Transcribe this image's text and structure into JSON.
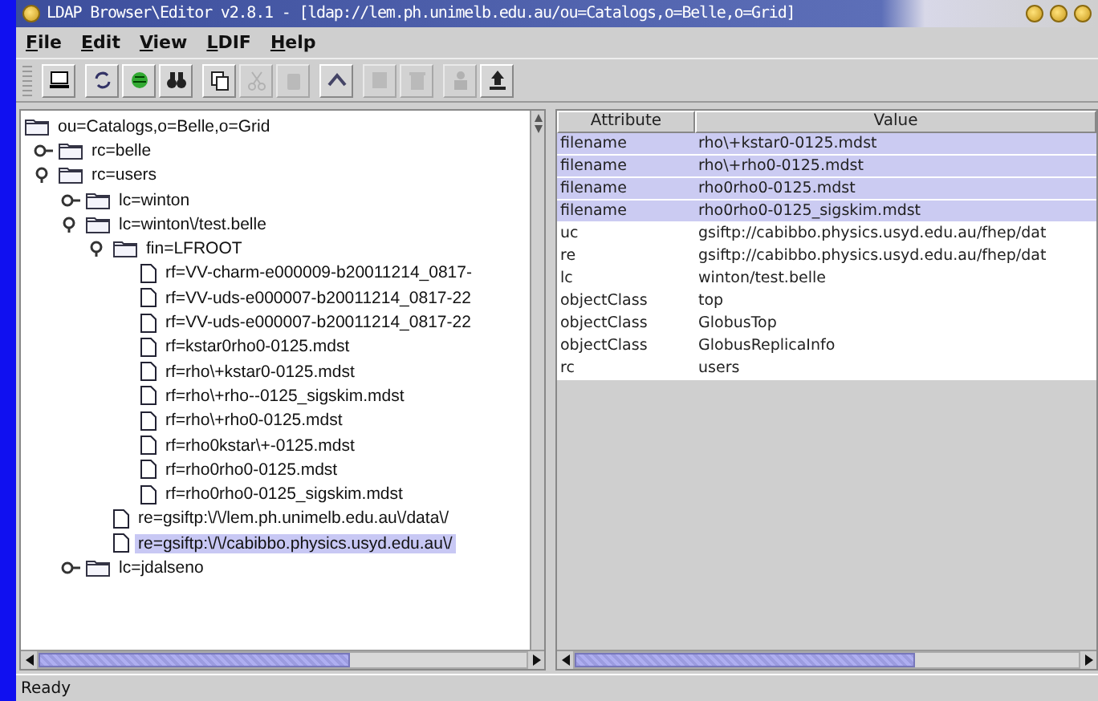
{
  "window": {
    "title": "LDAP Browser\\Editor v2.8.1 - [ldap://lem.ph.unimelb.edu.au/ou=Catalogs,o=Belle,o=Grid]"
  },
  "menu": [
    "File",
    "Edit",
    "View",
    "LDIF",
    "Help"
  ],
  "toolbar": [
    {
      "disabled": false
    },
    {
      "disabled": false
    },
    {
      "disabled": false
    },
    {
      "disabled": false
    },
    {
      "disabled": false
    },
    {
      "disabled": true
    },
    {
      "disabled": true
    },
    {
      "disabled": false
    },
    {
      "disabled": true
    },
    {
      "disabled": true
    },
    {
      "disabled": true
    },
    {
      "disabled": false
    }
  ],
  "tree": [
    {
      "label": "ou=Catalogs,o=Belle,o=Grid",
      "kind": "folder",
      "selected": false,
      "children": [
        {
          "label": "rc=belle",
          "kind": "folder",
          "expanded": false,
          "selected": false
        },
        {
          "label": "rc=users",
          "kind": "folder",
          "expanded": true,
          "selected": false,
          "children": [
            {
              "label": "lc=winton",
              "kind": "folder",
              "expanded": false,
              "selected": false
            },
            {
              "label": "lc=winton\\/test.belle",
              "kind": "folder",
              "expanded": true,
              "selected": false,
              "children": [
                {
                  "label": "fin=LFROOT",
                  "kind": "folder",
                  "expanded": true,
                  "selected": false,
                  "children": [
                    {
                      "label": "rf=VV-charm-e000009-b20011214_0817-",
                      "kind": "file",
                      "selected": false
                    },
                    {
                      "label": "rf=VV-uds-e000007-b20011214_0817-22",
                      "kind": "file",
                      "selected": false
                    },
                    {
                      "label": "rf=VV-uds-e000007-b20011214_0817-22",
                      "kind": "file",
                      "selected": false
                    },
                    {
                      "label": "rf=kstar0rho0-0125.mdst",
                      "kind": "file",
                      "selected": false
                    },
                    {
                      "label": "rf=rho\\+kstar0-0125.mdst",
                      "kind": "file",
                      "selected": false
                    },
                    {
                      "label": "rf=rho\\+rho--0125_sigskim.mdst",
                      "kind": "file",
                      "selected": false
                    },
                    {
                      "label": "rf=rho\\+rho0-0125.mdst",
                      "kind": "file",
                      "selected": false
                    },
                    {
                      "label": "rf=rho0kstar\\+-0125.mdst",
                      "kind": "file",
                      "selected": false
                    },
                    {
                      "label": "rf=rho0rho0-0125.mdst",
                      "kind": "file",
                      "selected": false
                    },
                    {
                      "label": "rf=rho0rho0-0125_sigskim.mdst",
                      "kind": "file",
                      "selected": false
                    }
                  ]
                },
                {
                  "label": "re=gsiftp:\\/\\/lem.ph.unimelb.edu.au\\/data\\/",
                  "kind": "file",
                  "selected": false
                },
                {
                  "label": "re=gsiftp:\\/\\/cabibbo.physics.usyd.edu.au\\/",
                  "kind": "file",
                  "selected": true
                }
              ]
            },
            {
              "label": "lc=jdalseno",
              "kind": "folder",
              "expanded": false,
              "selected": false
            }
          ]
        }
      ]
    }
  ],
  "table": {
    "columns": [
      "Attribute",
      "Value"
    ],
    "rows": [
      {
        "attribute": "filename",
        "value": "rho\\+kstar0-0125.mdst",
        "selected": true
      },
      {
        "attribute": "filename",
        "value": "rho\\+rho0-0125.mdst",
        "selected": true
      },
      {
        "attribute": "filename",
        "value": "rho0rho0-0125.mdst",
        "selected": true
      },
      {
        "attribute": "filename",
        "value": "rho0rho0-0125_sigskim.mdst",
        "selected": true
      },
      {
        "attribute": "uc",
        "value": "gsiftp://cabibbo.physics.usyd.edu.au/fhep/dat",
        "selected": false
      },
      {
        "attribute": "re",
        "value": "gsiftp://cabibbo.physics.usyd.edu.au/fhep/dat",
        "selected": false
      },
      {
        "attribute": "lc",
        "value": "winton/test.belle",
        "selected": false
      },
      {
        "attribute": "objectClass",
        "value": "top",
        "selected": false
      },
      {
        "attribute": "objectClass",
        "value": "GlobusTop",
        "selected": false
      },
      {
        "attribute": "objectClass",
        "value": "GlobusReplicaInfo",
        "selected": false
      },
      {
        "attribute": "rc",
        "value": "users",
        "selected": false
      }
    ]
  },
  "status_bar": "Ready"
}
